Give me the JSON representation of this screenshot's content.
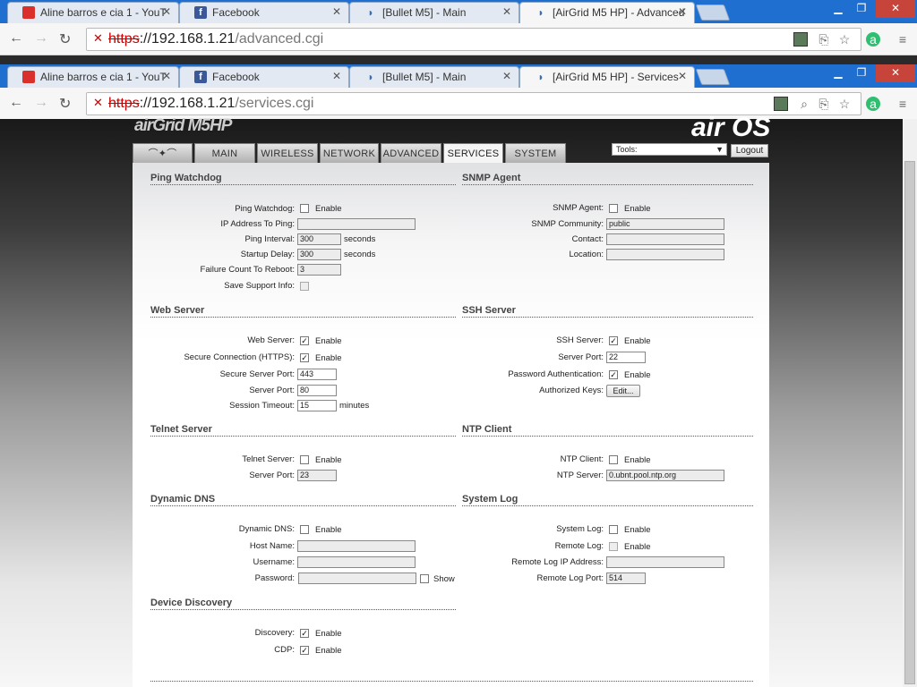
{
  "browser_back": {
    "tabs": [
      {
        "title": "Aline barros e cia 1 - YouT",
        "icon": "youtube-icon"
      },
      {
        "title": "Facebook",
        "icon": "facebook-icon"
      },
      {
        "title": "[Bullet M5] - Main",
        "icon": "ubiquiti-icon"
      },
      {
        "title": "[AirGrid M5 HP] - Advanced",
        "icon": "ubiquiti-icon"
      }
    ],
    "url": {
      "scheme": "https",
      "host": "://192.168.1.21",
      "path": "/advanced.cgi"
    }
  },
  "browser": {
    "tabs": [
      {
        "title": "Aline barros e cia 1 - YouT",
        "icon": "youtube-icon"
      },
      {
        "title": "Facebook",
        "icon": "facebook-icon"
      },
      {
        "title": "[Bullet M5] - Main",
        "icon": "ubiquiti-icon"
      },
      {
        "title": "[AirGrid M5 HP] - Services",
        "icon": "ubiquiti-icon"
      }
    ],
    "url": {
      "scheme": "https",
      "host": "://192.168.1.21",
      "path": "/services.cgi"
    }
  },
  "header": {
    "logo_text": "airGrid M5HP",
    "brand_text": "air OS",
    "tabs": [
      "MAIN",
      "WIRELESS",
      "NETWORK",
      "ADVANCED",
      "SERVICES",
      "SYSTEM"
    ],
    "tools_label": "Tools:",
    "logout": "Logout"
  },
  "units": {
    "seconds": "seconds",
    "minutes": "minutes",
    "enable": "Enable",
    "show": "Show"
  },
  "ping": {
    "title": "Ping Watchdog",
    "ping_watchdog": "Ping Watchdog:",
    "ip": "IP Address To Ping:",
    "interval": "Ping Interval:",
    "interval_value": "300",
    "startup": "Startup Delay:",
    "startup_value": "300",
    "failure": "Failure Count To Reboot:",
    "failure_value": "3",
    "support": "Save Support Info:"
  },
  "snmp": {
    "title": "SNMP Agent",
    "agent": "SNMP Agent:",
    "community": "SNMP Community:",
    "community_value": "public",
    "contact": "Contact:",
    "location": "Location:"
  },
  "web": {
    "title": "Web Server",
    "server": "Web Server:",
    "https": "Secure Connection (HTTPS):",
    "secure_port": "Secure Server Port:",
    "secure_port_value": "443",
    "port": "Server Port:",
    "port_value": "80",
    "timeout": "Session Timeout:",
    "timeout_value": "15"
  },
  "ssh": {
    "title": "SSH Server",
    "server": "SSH Server:",
    "port": "Server Port:",
    "port_value": "22",
    "password": "Password Authentication:",
    "keys": "Authorized Keys:",
    "edit": "Edit..."
  },
  "telnet": {
    "title": "Telnet Server",
    "server": "Telnet Server:",
    "port": "Server Port:",
    "port_value": "23"
  },
  "ntp": {
    "title": "NTP Client",
    "client": "NTP Client:",
    "server": "NTP Server:",
    "server_value": "0.ubnt.pool.ntp.org"
  },
  "ddns": {
    "title": "Dynamic DNS",
    "dns": "Dynamic DNS:",
    "host": "Host Name:",
    "user": "Username:",
    "pass": "Password:"
  },
  "syslog": {
    "title": "System Log",
    "log": "System Log:",
    "remote": "Remote Log:",
    "remote_ip": "Remote Log IP Address:",
    "remote_port": "Remote Log Port:",
    "remote_port_value": "514"
  },
  "discovery": {
    "title": "Device Discovery",
    "discovery": "Discovery:",
    "cdp": "CDP:"
  }
}
